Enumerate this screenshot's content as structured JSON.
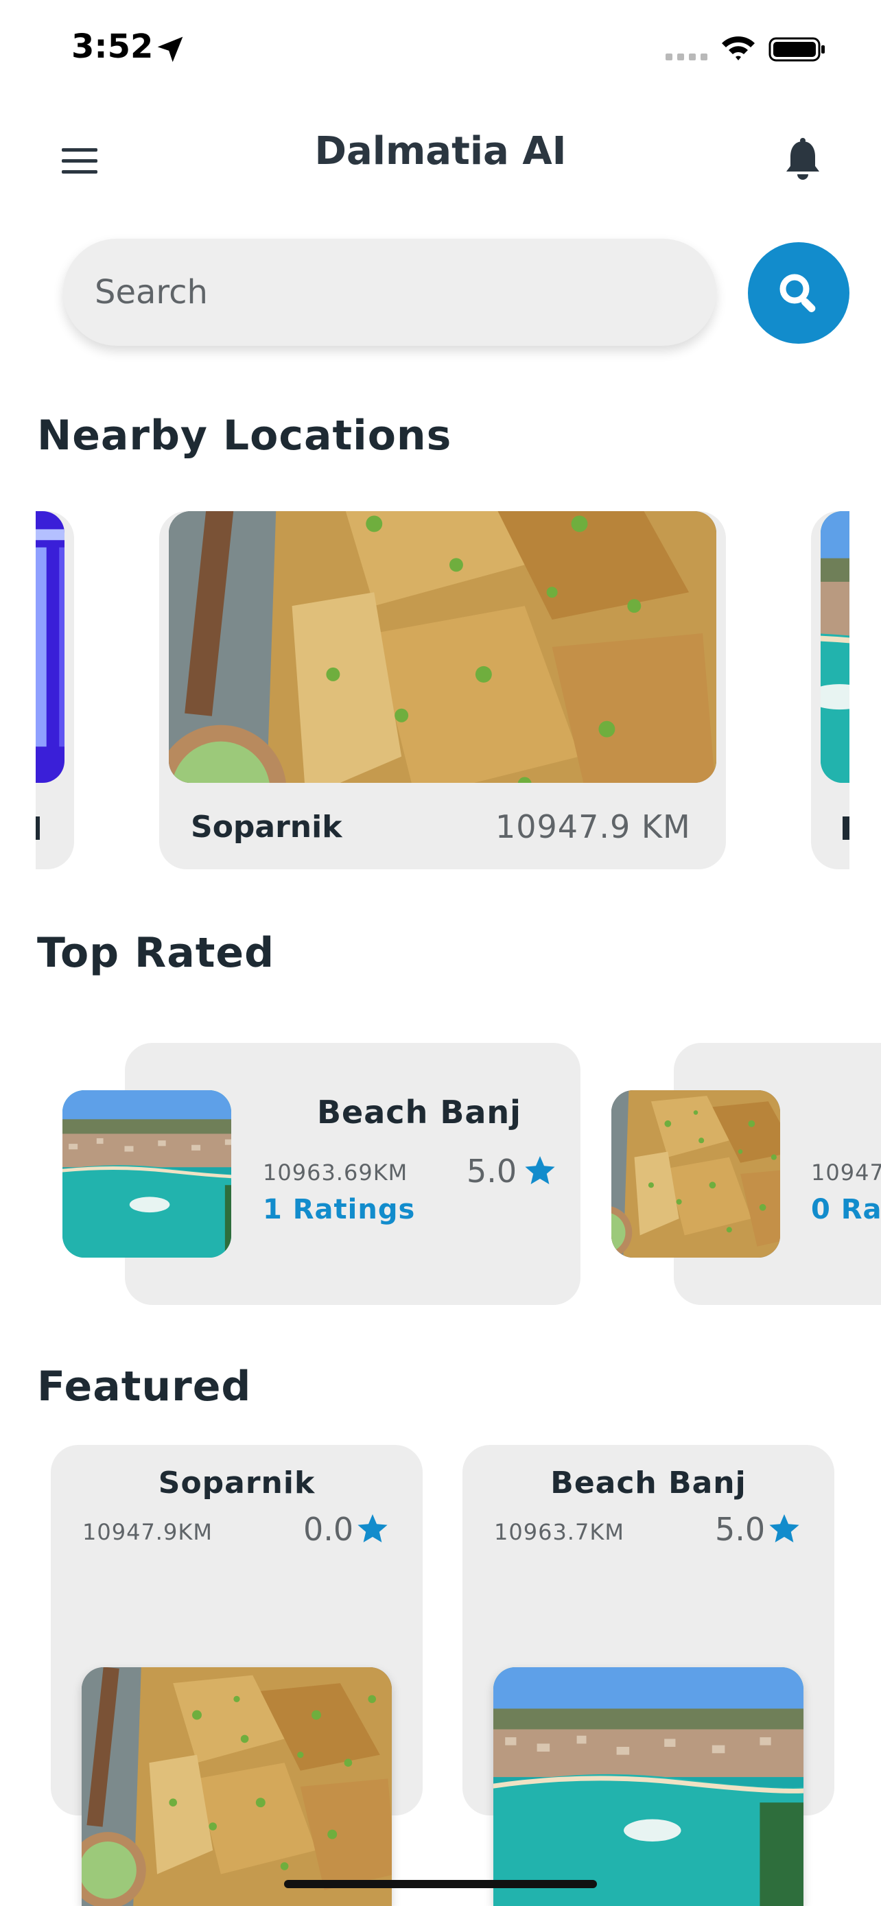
{
  "status_bar": {
    "time": "3:52"
  },
  "header": {
    "title": "Dalmatia AI"
  },
  "search": {
    "placeholder": "Search"
  },
  "nearby": {
    "title": "Nearby Locations",
    "cards": [
      {
        "name": "Soparnik",
        "distance": "10947.9 KM"
      }
    ]
  },
  "top_rated": {
    "title": "Top Rated",
    "cards": [
      {
        "name": "Beach Banj",
        "distance": "10963.69KM",
        "rating": "5.0",
        "ratings_count": "1 Ratings"
      },
      {
        "distance_partial": "10947.",
        "ratings_partial": "0 Rat"
      }
    ]
  },
  "featured": {
    "title": "Featured",
    "cards": [
      {
        "name": "Soparnik",
        "distance": "10947.9KM",
        "rating": "0.0"
      },
      {
        "name": "Beach Banj",
        "distance": "10963.7KM",
        "rating": "5.0"
      }
    ]
  },
  "colors": {
    "accent": "#128ccc",
    "card": "#ededed",
    "text": "#1e2a33"
  }
}
